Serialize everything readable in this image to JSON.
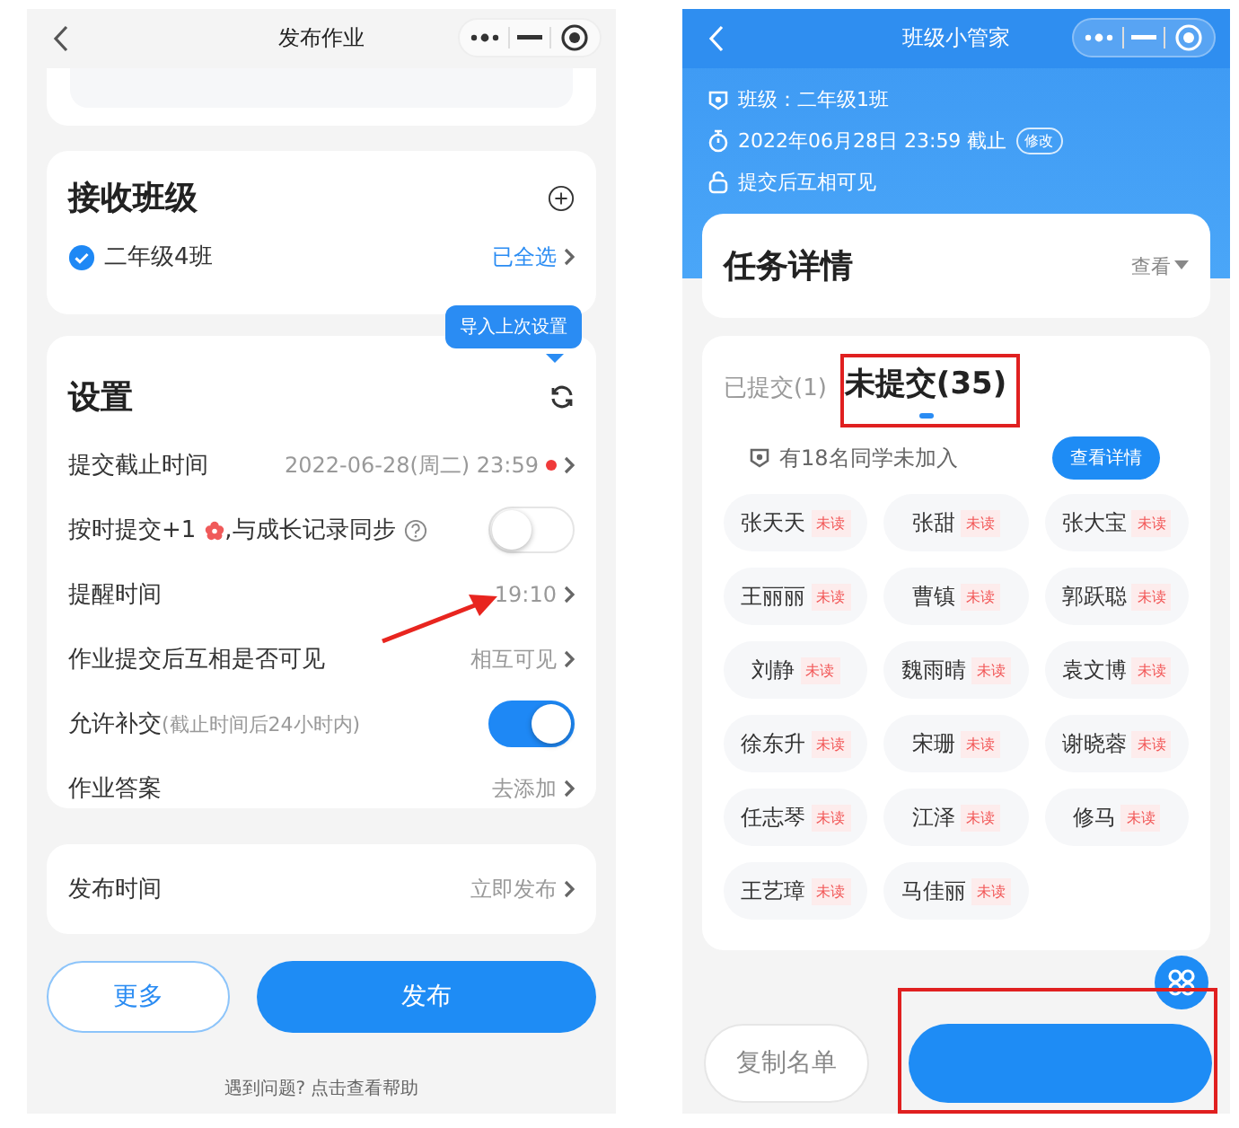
{
  "left": {
    "nav": {
      "title": "发布作业"
    },
    "classes": {
      "title": "接收班级",
      "items": [
        {
          "name": "二年级4班",
          "checked": true
        }
      ],
      "status": "已全选"
    },
    "tooltip": "导入上次设置",
    "settings": {
      "title": "设置",
      "rows": [
        {
          "kind": "value",
          "label": "提交截止时间",
          "value": "2022-06-28(周二) 23:59",
          "alert": true
        },
        {
          "kind": "toggle",
          "label": "按时提交+1",
          "after_icon": ",与成长记录同步",
          "on": false
        },
        {
          "kind": "value",
          "label": "提醒时间",
          "value": "19:10",
          "alert": false
        },
        {
          "kind": "value",
          "label": "作业提交后互相是否可见",
          "value": "相互可见",
          "alert": false
        },
        {
          "kind": "toggle",
          "label": "允许补交",
          "note": "(截止时间后24小时内)",
          "on": true
        },
        {
          "kind": "value",
          "label": "作业答案",
          "value": "去添加",
          "alert": false
        }
      ]
    },
    "publish_time": {
      "label": "发布时间",
      "value": "立即发布"
    },
    "buttons": [
      {
        "label": "更多",
        "kind": "outline"
      },
      {
        "label": "发布",
        "kind": "primary"
      }
    ],
    "help": "遇到问题? 点击查看帮助"
  },
  "right": {
    "nav": {
      "title": "班级小管家"
    },
    "info": [
      {
        "kind": "class",
        "text": "班级：二年级1班"
      },
      {
        "kind": "deadline",
        "text": "2022年06月28日 23:59 截止",
        "badge": "修改"
      },
      {
        "kind": "visibility",
        "text": "提交后互相可见"
      }
    ],
    "task": {
      "title": "任务详情",
      "action": "查看"
    },
    "tabs": [
      {
        "label": "已提交(1)",
        "selected": false
      },
      {
        "label": "未提交(35)",
        "selected": true
      }
    ],
    "notice": {
      "text": "有18名同学未加入",
      "button": "查看详情"
    },
    "students": [
      {
        "name": "张天天",
        "status": "未读"
      },
      {
        "name": "张甜",
        "status": "未读"
      },
      {
        "name": "张大宝",
        "status": "未读"
      },
      {
        "name": "王丽丽",
        "status": "未读"
      },
      {
        "name": "曹镇",
        "status": "未读"
      },
      {
        "name": "郭跃聪",
        "status": "未读"
      },
      {
        "name": "刘静",
        "status": "未读"
      },
      {
        "name": "魏雨晴",
        "status": "未读"
      },
      {
        "name": "袁文博",
        "status": "未读"
      },
      {
        "name": "徐东升",
        "status": "未读"
      },
      {
        "name": "宋珊",
        "status": "未读"
      },
      {
        "name": "谢晓蓉",
        "status": "未读"
      },
      {
        "name": "任志琴",
        "status": "未读"
      },
      {
        "name": "江泽",
        "status": "未读"
      },
      {
        "name": "修马",
        "status": "未读"
      },
      {
        "name": "王艺璋",
        "status": "未读"
      },
      {
        "name": "马佳丽",
        "status": "未读"
      }
    ],
    "bottom_buttons": [
      {
        "label": "复制名单",
        "kind": "outline"
      },
      {
        "kind": "primary"
      }
    ]
  }
}
